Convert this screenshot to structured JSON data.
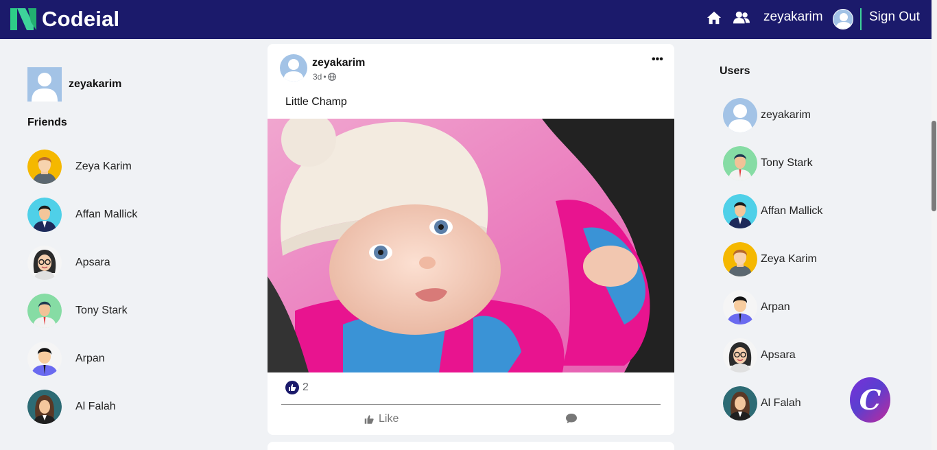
{
  "navbar": {
    "logo_text": "Codeial",
    "username": "zeyakarim",
    "signout_label": "Sign Out"
  },
  "left_sidebar": {
    "profile_name": "zeyakarim",
    "friends_title": "Friends",
    "friends": [
      {
        "name": "Zeya Karim",
        "avatar": "orange-hair-avatar"
      },
      {
        "name": "Affan Mallick",
        "avatar": "suit-man-avatar"
      },
      {
        "name": "Apsara",
        "avatar": "glasses-woman-avatar"
      },
      {
        "name": "Tony Stark",
        "avatar": "green-man-avatar"
      },
      {
        "name": "Arpan",
        "avatar": "black-hair-man-avatar"
      },
      {
        "name": "Al Falah",
        "avatar": "woman-teal-avatar"
      }
    ]
  },
  "post": {
    "author": "zeyakarim",
    "time": "3d",
    "visibility_icon": "globe-icon",
    "text": "Little Champ",
    "like_count": "2",
    "like_label": "Like"
  },
  "right_sidebar": {
    "users_title": "Users",
    "users": [
      {
        "name": "zeyakarim",
        "avatar": "default-avatar"
      },
      {
        "name": "Tony Stark",
        "avatar": "green-man-avatar"
      },
      {
        "name": "Affan Mallick",
        "avatar": "suit-man-avatar"
      },
      {
        "name": "Zeya Karim",
        "avatar": "orange-hair-avatar"
      },
      {
        "name": "Arpan",
        "avatar": "black-hair-man-avatar"
      },
      {
        "name": "Apsara",
        "avatar": "glasses-woman-avatar"
      },
      {
        "name": "Al Falah",
        "avatar": "woman-teal-avatar"
      }
    ]
  },
  "fab": {
    "letter": "C"
  },
  "colors": {
    "navbar": "#1b1a6b",
    "accent": "#3ed39a",
    "background": "#f0f2f5"
  }
}
